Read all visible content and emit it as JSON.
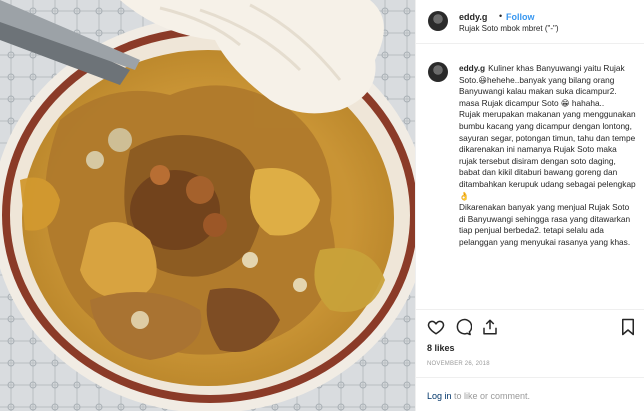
{
  "header": {
    "username": "eddy.g",
    "separator": "•",
    "follow_label": "Follow",
    "location": "Rujak Soto mbok mbret (\"-\")"
  },
  "caption": {
    "username": "eddy.g",
    "lines": [
      "Kuliner khas Banyuwangi yaitu Rujak Soto.😆hehehe..banyak yang bilang orang Banyuwangi kalau makan suka dicampur2. masa Rujak dicampur Soto 😁 hahaha..",
      "Rujak merupakan makanan yang menggunakan bumbu kacang yang dicampur dengan lontong, sayuran segar, potongan timun, tahu dan tempe dikarenakan ini namanya Rujak Soto maka rujak tersebut disiram dengan soto daging, babat dan kikil ditaburi bawang goreng dan ditambahkan kerupuk udang sebagai pelengkap 👌",
      "Dikarenakan banyak yang menjual Rujak Soto di Banyuwangi sehingga rasa yang ditawarkan tiap penjual berbeda2. tetapi selalu ada pelanggan yang menyukai rasanya yang khas."
    ]
  },
  "actions": {
    "like_icon": "heart-icon",
    "comment_icon": "comment-icon",
    "share_icon": "share-icon",
    "save_icon": "bookmark-icon"
  },
  "likes": "8 likes",
  "date": "NOVEMBER 26, 2018",
  "footer": {
    "login_label": "Log in",
    "rest": " to like or comment."
  },
  "colors": {
    "follow": "#3897f0",
    "link": "#003569",
    "muted": "#999999",
    "border": "#efefef"
  }
}
